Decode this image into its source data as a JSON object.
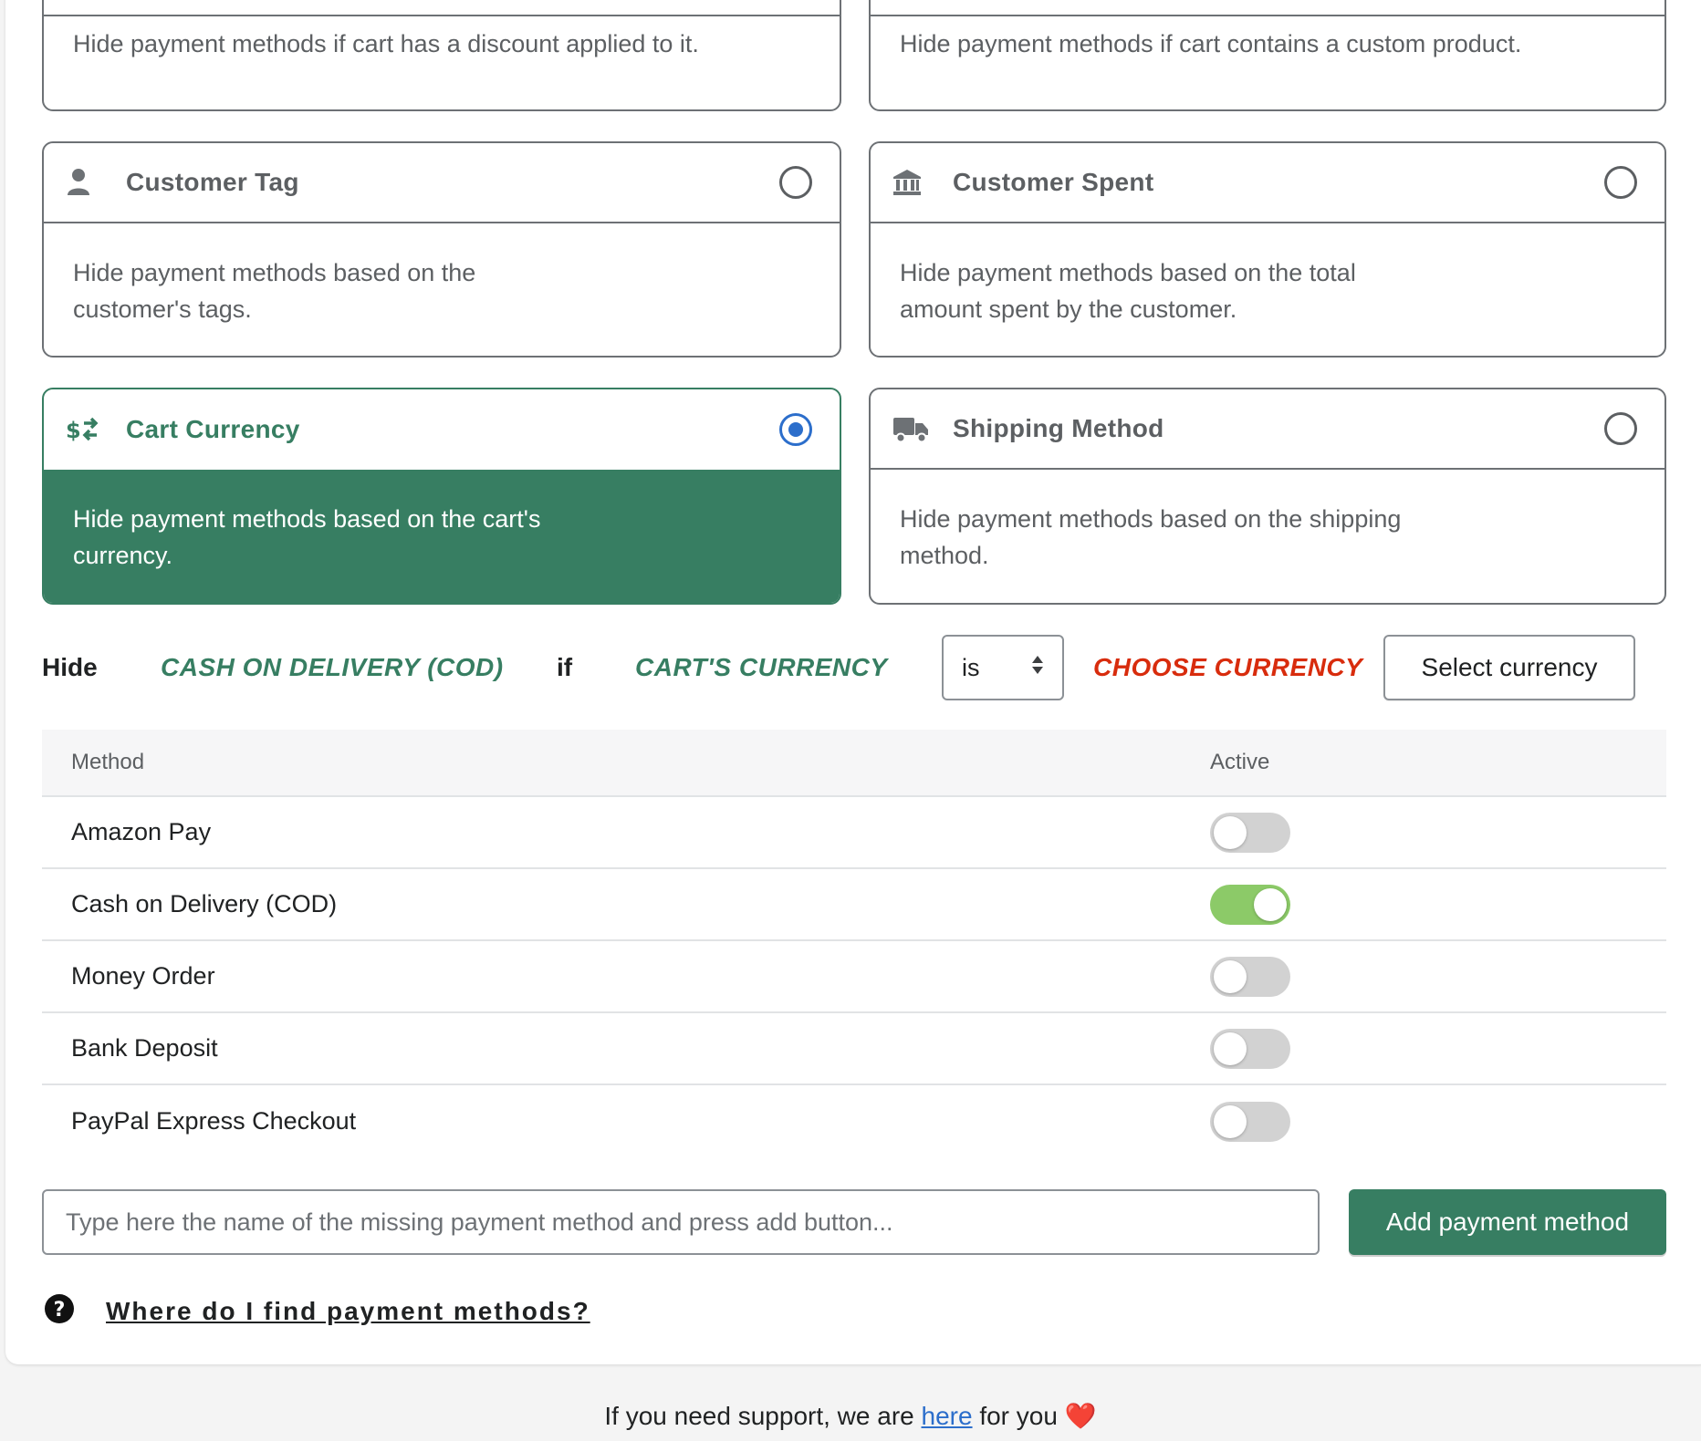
{
  "top_cards": [
    {
      "description": "Hide payment methods if cart has a discount applied to it."
    },
    {
      "description": "Hide payment methods if cart contains a custom product."
    }
  ],
  "cards": [
    {
      "title": "Customer Tag",
      "description": "Hide payment methods based on the customer's tags.",
      "icon": "person-icon",
      "selected": false
    },
    {
      "title": "Customer Spent",
      "description": "Hide payment methods based on the total amount spent by the customer.",
      "icon": "bank-icon",
      "selected": false
    },
    {
      "title": "Cart Currency",
      "description": "Hide payment methods based on the cart's currency.",
      "icon": "currency-exchange-icon",
      "selected": true
    },
    {
      "title": "Shipping Method",
      "description": "Hide payment methods based on the shipping method.",
      "icon": "truck-icon",
      "selected": false
    }
  ],
  "condition": {
    "hide_label": "Hide",
    "method": "CASH ON DELIVERY (COD)",
    "if_label": "if",
    "subject": "CART'S CURRENCY",
    "operator": "is",
    "target": "CHOOSE CURRENCY",
    "select_button": "Select currency"
  },
  "table": {
    "headers": {
      "method": "Method",
      "active": "Active"
    },
    "rows": [
      {
        "method": "Amazon Pay",
        "active": false
      },
      {
        "method": "Cash on Delivery (COD)",
        "active": true
      },
      {
        "method": "Money Order",
        "active": false
      },
      {
        "method": "Bank Deposit",
        "active": false
      },
      {
        "method": "PayPal Express Checkout",
        "active": false
      }
    ]
  },
  "add": {
    "placeholder": "Type here the name of the missing payment method and press add button...",
    "button": "Add payment method"
  },
  "help": {
    "link": "Where do I find payment methods?"
  },
  "footer": {
    "prefix": "If you need support, we are",
    "link": "here",
    "suffix": "for you",
    "heart": "❤️"
  },
  "colors": {
    "accent": "#377e62",
    "danger": "#d82c0d",
    "radio": "#2c6ecb",
    "toggle_on": "#8cca68"
  }
}
